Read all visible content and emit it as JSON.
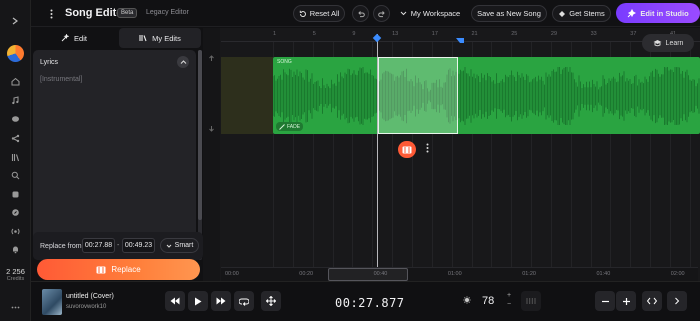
{
  "rail": {
    "credits_value": "2 256",
    "credits_label": "Credits"
  },
  "header": {
    "title": "Song Editor",
    "badge": "Beta",
    "legacy_link": "Legacy Editor",
    "reset_all": "Reset All",
    "workspace": "My Workspace",
    "save_new_song": "Save as New Song",
    "get_stems": "Get Stems",
    "edit_in_studio": "Edit in Studio"
  },
  "panel": {
    "tabs": [
      "Edit",
      "My Edits"
    ],
    "lyrics_title": "Lyrics",
    "lyrics_text": "[Instrumental]",
    "replace_from_label": "Replace from",
    "from_time": "00:27.88",
    "dash": "-",
    "to_time": "00:49.23",
    "smart_label": "Smart",
    "replace_button": "Replace"
  },
  "timeline": {
    "ruler_ticks": [
      "1",
      "5",
      "9",
      "13",
      "17",
      "21",
      "25",
      "29",
      "33",
      "37",
      "41",
      "45"
    ],
    "clip_label": "SONG",
    "fade_label": "FADE",
    "learn": "Learn",
    "overview_ticks": [
      "00:00",
      "00:20",
      "00:40",
      "01:00",
      "01:20",
      "01:40",
      "02:00"
    ]
  },
  "player": {
    "song_title": "untitled (Cover)",
    "song_user": "suvorovwork10",
    "current_time": "00:27.877",
    "bpm": "78",
    "bpm_plus": "+",
    "bpm_minus": "−"
  },
  "colors": {
    "accent_purple": "#8a44ff",
    "replace_orange": "#ff6a3a",
    "clip_green": "#2aa441",
    "playhead_blue": "#3b8cff"
  }
}
